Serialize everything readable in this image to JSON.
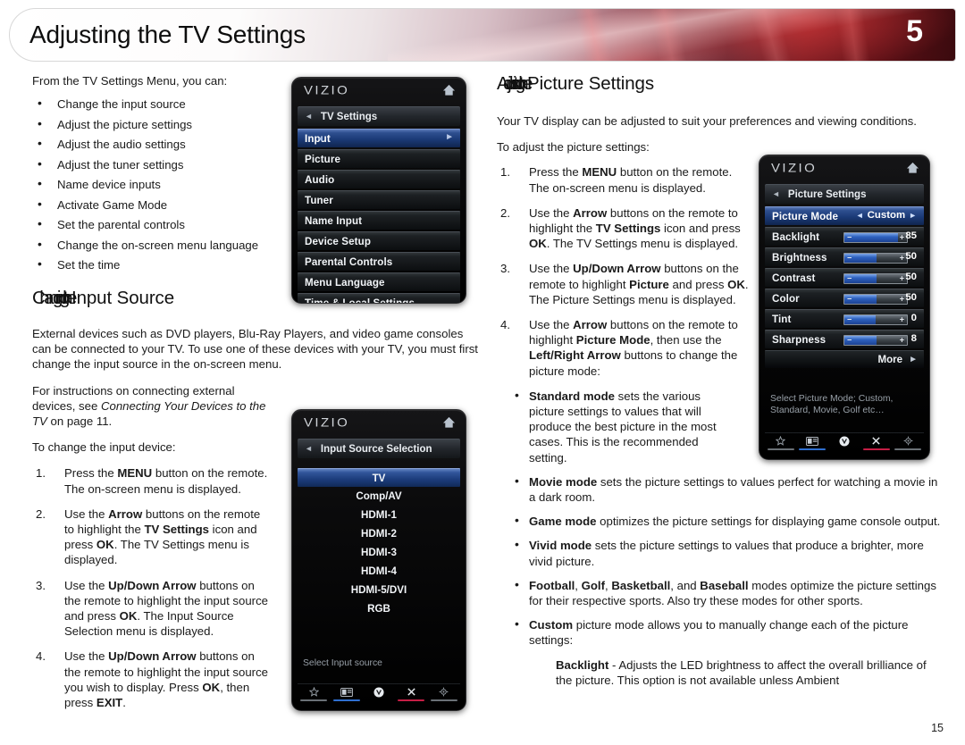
{
  "header": {
    "title": "Adjusting the TV Settings",
    "page_number": "5",
    "accent_dark": "#5c1016",
    "accent_red": "#7a1c22"
  },
  "page_footer": "15",
  "left_column": {
    "intro": "From the TV Settings Menu, you can:",
    "bullets": [
      "Change the input source",
      "Adjust the picture settings",
      "Adjust the audio settings",
      "Adjust the tuner settings",
      "Name device inputs",
      "Activate Game Mode",
      "Set the parental controls",
      "Change the on-screen menu language",
      "Set the time"
    ],
    "section_title_a": "Changing the",
    "section_title_b": "Input Source",
    "para_1": "External devices such as DVD players, Blu-Ray Players, and video game consoles can be connected to your TV. To use one of these devices with your TV, you must first change the input source in the on-screen menu.",
    "para_2_pre": "For instructions on connecting external devices, see ",
    "para_2_italic": "Connecting Your Devices to the TV",
    "para_2_post": " on page 11.",
    "para_3": "To change the input device:",
    "steps": [
      {
        "parts": [
          {
            "t": "Press the ",
            "b": false
          },
          {
            "t": "MENU",
            "b": true
          },
          {
            "t": " button on the remote. The on-screen menu is displayed.",
            "b": false
          }
        ]
      },
      {
        "parts": [
          {
            "t": "Use the ",
            "b": false
          },
          {
            "t": "Arrow",
            "b": true
          },
          {
            "t": " buttons on the remote to highlight the ",
            "b": false
          },
          {
            "t": "TV Settings",
            "b": true
          },
          {
            "t": " icon and press ",
            "b": false
          },
          {
            "t": "OK",
            "b": true
          },
          {
            "t": ". The TV Settings menu is displayed.",
            "b": false
          }
        ]
      },
      {
        "parts": [
          {
            "t": "Use the ",
            "b": false
          },
          {
            "t": "Up/Down Arrow",
            "b": true
          },
          {
            "t": " buttons on the remote to highlight the input source and press ",
            "b": false
          },
          {
            "t": "OK",
            "b": true
          },
          {
            "t": ". The Input Source Selection menu is displayed.",
            "b": false
          }
        ]
      },
      {
        "parts": [
          {
            "t": "Use the ",
            "b": false
          },
          {
            "t": "Up/Down Arrow",
            "b": true
          },
          {
            "t": " buttons on the remote to highlight the input source you wish to display. Press ",
            "b": false
          },
          {
            "t": "OK",
            "b": true
          },
          {
            "t": ", then press ",
            "b": false
          },
          {
            "t": "EXIT",
            "b": true
          },
          {
            "t": ".",
            "b": false
          }
        ]
      }
    ]
  },
  "right_column": {
    "section_title_a": "Adjusting the",
    "section_title_b": "Picture Settings",
    "para_1": "Your TV display can be adjusted to suit your preferences and viewing conditions.",
    "para_2": "To adjust the picture settings:",
    "steps": [
      {
        "parts": [
          {
            "t": "Press the ",
            "b": false
          },
          {
            "t": "MENU",
            "b": true
          },
          {
            "t": " button on the remote. The on-screen menu is displayed.",
            "b": false
          }
        ]
      },
      {
        "parts": [
          {
            "t": "Use the ",
            "b": false
          },
          {
            "t": "Arrow",
            "b": true
          },
          {
            "t": " buttons on the remote to highlight the ",
            "b": false
          },
          {
            "t": "TV Settings",
            "b": true
          },
          {
            "t": " icon and press ",
            "b": false
          },
          {
            "t": "OK",
            "b": true
          },
          {
            "t": ". The TV Settings menu is displayed.",
            "b": false
          }
        ]
      },
      {
        "parts": [
          {
            "t": "Use the ",
            "b": false
          },
          {
            "t": "Up/Down Arrow",
            "b": true
          },
          {
            "t": " buttons on the remote to highlight ",
            "b": false
          },
          {
            "t": "Picture",
            "b": true
          },
          {
            "t": " and press ",
            "b": false
          },
          {
            "t": "OK",
            "b": true
          },
          {
            "t": ". The Picture Settings menu is displayed.",
            "b": false
          }
        ]
      },
      {
        "parts": [
          {
            "t": "Use the ",
            "b": false
          },
          {
            "t": "Arrow",
            "b": true
          },
          {
            "t": " buttons on the remote to highlight ",
            "b": false
          },
          {
            "t": "Picture Mode",
            "b": true
          },
          {
            "t": ", then use the ",
            "b": false
          },
          {
            "t": "Left/Right Arrow",
            "b": true
          },
          {
            "t": " buttons to change the picture mode:",
            "b": false
          }
        ]
      }
    ],
    "mode_bullets": [
      {
        "narrow": true,
        "parts": [
          {
            "t": "Standard mode",
            "b": true
          },
          {
            "t": " sets the various picture settings to values that will produce the best picture in the most cases. This is the recommended setting.",
            "b": false
          }
        ]
      },
      {
        "narrow": false,
        "parts": [
          {
            "t": "Movie mode",
            "b": true
          },
          {
            "t": " sets the picture settings to values perfect for watching a movie in a dark room.",
            "b": false
          }
        ]
      },
      {
        "narrow": false,
        "parts": [
          {
            "t": "Game mode",
            "b": true
          },
          {
            "t": " optimizes the picture settings for displaying game console output.",
            "b": false
          }
        ]
      },
      {
        "narrow": false,
        "parts": [
          {
            "t": "Vivid mode",
            "b": true
          },
          {
            "t": " sets the picture settings to values that produce a brighter, more vivid picture.",
            "b": false
          }
        ]
      },
      {
        "narrow": false,
        "parts": [
          {
            "t": "Football",
            "b": true
          },
          {
            "t": ", ",
            "b": false
          },
          {
            "t": "Golf",
            "b": true
          },
          {
            "t": ", ",
            "b": false
          },
          {
            "t": "Basketball",
            "b": true
          },
          {
            "t": ", and ",
            "b": false
          },
          {
            "t": "Baseball",
            "b": true
          },
          {
            "t": " modes optimize the picture settings for their respective sports. Also try these modes for other sports.",
            "b": false
          }
        ]
      },
      {
        "narrow": false,
        "parts": [
          {
            "t": "Custom",
            "b": true
          },
          {
            "t": " picture mode allows you to manually change each of the picture settings:",
            "b": false
          }
        ]
      }
    ],
    "backlight_note": {
      "parts": [
        {
          "t": "Backlight",
          "b": true
        },
        {
          "t": " - Adjusts the LED brightness to affect the overall brilliance of the picture. This option is not available unless Ambient",
          "b": false
        }
      ]
    }
  },
  "osd_tv_settings": {
    "brand": "VIZIO",
    "home_icon": "home-icon",
    "breadcrumb": "TV Settings",
    "rows": [
      {
        "label": "Input",
        "selected": true,
        "has_arrow": true
      },
      {
        "label": "Picture",
        "selected": false,
        "has_arrow": false
      },
      {
        "label": "Audio",
        "selected": false,
        "has_arrow": false
      },
      {
        "label": "Tuner",
        "selected": false,
        "has_arrow": false
      },
      {
        "label": "Name Input",
        "selected": false,
        "has_arrow": false
      },
      {
        "label": "Device Setup",
        "selected": false,
        "has_arrow": false
      },
      {
        "label": "Parental Controls",
        "selected": false,
        "has_arrow": false
      },
      {
        "label": "Menu Language",
        "selected": false,
        "has_arrow": false
      },
      {
        "label": "Time & Local Settings",
        "selected": false,
        "has_arrow": false
      }
    ]
  },
  "osd_input_source": {
    "brand": "VIZIO",
    "breadcrumb": "Input Source Selection",
    "items": [
      {
        "label": "TV",
        "selected": true
      },
      {
        "label": "Comp/AV",
        "selected": false
      },
      {
        "label": "HDMI-1",
        "selected": false
      },
      {
        "label": "HDMI-2",
        "selected": false
      },
      {
        "label": "HDMI-3",
        "selected": false
      },
      {
        "label": "HDMI-4",
        "selected": false
      },
      {
        "label": "HDMI-5/DVI",
        "selected": false
      },
      {
        "label": "RGB",
        "selected": false
      }
    ],
    "help_text": "Select Input source",
    "toolbar": [
      {
        "icon": "star-icon",
        "bar": "gray"
      },
      {
        "icon": "tv-display-icon",
        "bar": "blue"
      },
      {
        "icon": "vizio-v-icon",
        "bar": "none"
      },
      {
        "icon": "close-x-icon",
        "bar": "red"
      },
      {
        "icon": "gear-icon",
        "bar": "gray"
      }
    ]
  },
  "osd_picture_settings": {
    "brand": "VIZIO",
    "breadcrumb": "Picture Settings",
    "picture_mode": {
      "label": "Picture Mode",
      "value": "Custom"
    },
    "sliders": [
      {
        "label": "Backlight",
        "value": "85",
        "fill_pct": 86
      },
      {
        "label": "Brightness",
        "value": "50",
        "fill_pct": 52
      },
      {
        "label": "Contrast",
        "value": "50",
        "fill_pct": 52
      },
      {
        "label": "Color",
        "value": "50",
        "fill_pct": 52
      },
      {
        "label": "Tint",
        "value": "0",
        "fill_pct": 50
      },
      {
        "label": "Sharpness",
        "value": "8",
        "fill_pct": 52
      }
    ],
    "more_label": "More",
    "help_text": "Select Picture Mode; Custom, Standard, Movie, Golf etc…",
    "toolbar": [
      {
        "icon": "star-icon",
        "bar": "gray"
      },
      {
        "icon": "tv-display-icon",
        "bar": "blue"
      },
      {
        "icon": "vizio-v-icon",
        "bar": "none"
      },
      {
        "icon": "close-x-icon",
        "bar": "red"
      },
      {
        "icon": "gear-icon",
        "bar": "gray"
      }
    ]
  }
}
